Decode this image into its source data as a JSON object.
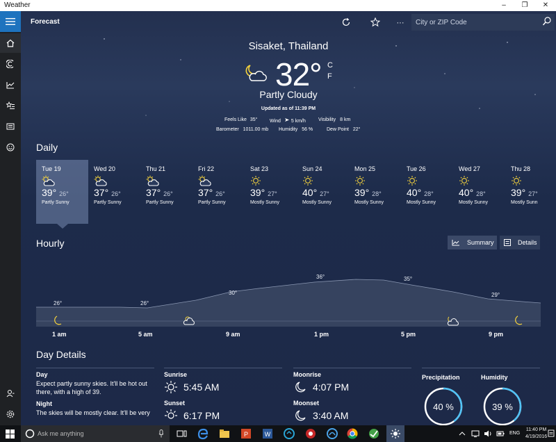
{
  "window": {
    "title": "Weather",
    "minimize": "–",
    "maximize": "❐",
    "close": "✕"
  },
  "appbar": {
    "title": "Forecast",
    "more": "···",
    "search_placeholder": "City or ZIP Code"
  },
  "current": {
    "location": "Sisaket, Thailand",
    "temperature": "32°",
    "unit_c": "C",
    "unit_f": "F",
    "condition": "Partly Cloudy",
    "updated": "Updated as of 11:39 PM",
    "feels_like_label": "Feels Like",
    "feels_like": "35°",
    "wind_label": "Wind",
    "wind": "5 km/h",
    "visibility_label": "Visibility",
    "visibility": "8 km",
    "barometer_label": "Barometer",
    "barometer": "1011.00 mb",
    "humidity_label": "Humidity",
    "humidity": "56 %",
    "dewpoint_label": "Dew Point",
    "dewpoint": "22°"
  },
  "daily": {
    "title": "Daily",
    "days": [
      {
        "name": "Tue 19",
        "high": "39°",
        "low": "26°",
        "cond": "Partly Sunny",
        "icon": "partly-sunny-icon"
      },
      {
        "name": "Wed 20",
        "high": "37°",
        "low": "26°",
        "cond": "Partly Sunny",
        "icon": "partly-sunny-icon"
      },
      {
        "name": "Thu 21",
        "high": "37°",
        "low": "26°",
        "cond": "Partly Sunny",
        "icon": "partly-sunny-icon"
      },
      {
        "name": "Fri 22",
        "high": "37°",
        "low": "26°",
        "cond": "Partly Sunny",
        "icon": "partly-sunny-icon"
      },
      {
        "name": "Sat 23",
        "high": "39°",
        "low": "27°",
        "cond": "Mostly Sunny",
        "icon": "sun-icon"
      },
      {
        "name": "Sun 24",
        "high": "40°",
        "low": "27°",
        "cond": "Mostly Sunny",
        "icon": "sun-icon"
      },
      {
        "name": "Mon 25",
        "high": "39°",
        "low": "28°",
        "cond": "Mostly Sunny",
        "icon": "sun-icon"
      },
      {
        "name": "Tue 26",
        "high": "40°",
        "low": "28°",
        "cond": "Mostly Sunny",
        "icon": "sun-icon"
      },
      {
        "name": "Wed 27",
        "high": "40°",
        "low": "28°",
        "cond": "Mostly Sunny",
        "icon": "sun-icon"
      },
      {
        "name": "Thu 28",
        "high": "39°",
        "low": "27°",
        "cond": "Mostly Sunn",
        "icon": "sun-icon"
      }
    ]
  },
  "hourly": {
    "title": "Hourly",
    "summary_label": "Summary",
    "details_label": "Details",
    "temps": [
      "26°",
      "26°",
      "30°",
      "36°",
      "35°",
      "29°"
    ],
    "times": [
      "1 am",
      "5 am",
      "9 am",
      "1 pm",
      "5 pm",
      "9 pm"
    ]
  },
  "day_details": {
    "title": "Day Details",
    "day_label": "Day",
    "day_text": "Expect partly sunny skies. It'll be hot out there, with a high of 39.",
    "night_label": "Night",
    "night_text": "The skies will be mostly clear. It'll be very",
    "sunrise_label": "Sunrise",
    "sunrise": "5:45 AM",
    "sunset_label": "Sunset",
    "sunset": "6:17 PM",
    "moonrise_label": "Moonrise",
    "moonrise": "4:07 PM",
    "moonset_label": "Moonset",
    "moonset": "3:40 AM",
    "precip_label": "Precipitation",
    "precip": "40 %",
    "precip_fraction": 0.4,
    "humidity_label": "Humidity",
    "humidity": "39 %",
    "humidity_fraction": 0.39,
    "ring_color": "#4fc3f7"
  },
  "taskbar": {
    "search_placeholder": "Ask me anything",
    "lang": "ENG",
    "time": "11:40 PM",
    "date": "4/19/2016"
  }
}
